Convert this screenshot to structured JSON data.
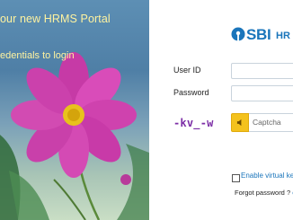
{
  "promo": {
    "headline": "our new  HRMS Portal",
    "subline": "edentials to login"
  },
  "brand": {
    "name": "SBI",
    "suffix": "HR",
    "color": "#1a75bb"
  },
  "form": {
    "user_id_label": "User ID",
    "password_label": "Password",
    "captcha_text": "-kv_-w",
    "captcha_placeholder": "Captcha",
    "virtual_keyboard_label": "Enable virtual key",
    "forgot_password_text": "Forgot password ?",
    "forgot_password_link": "c"
  },
  "icons": {
    "logo": "sbi-keyhole-logo-icon",
    "audio": "speaker-icon"
  }
}
